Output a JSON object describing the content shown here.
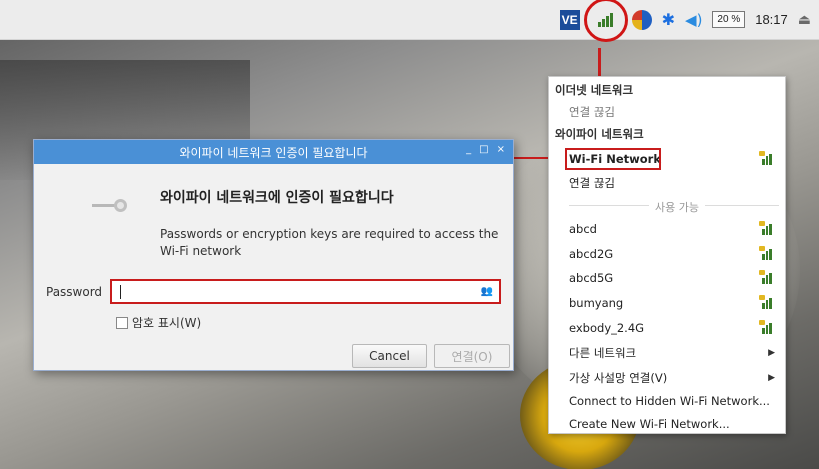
{
  "taskbar": {
    "vnc_label": "VE",
    "cpu_usage": "20 %",
    "clock": "18:17",
    "icons": [
      "vnc-icon",
      "wifi-icon",
      "globe-icon",
      "bluetooth-icon",
      "volume-icon",
      "eject-icon"
    ]
  },
  "wifi_menu": {
    "ethernet_header": "이더넷 네트워크",
    "ethernet_status": "연결 끊김",
    "wifi_header": "와이파이 네트워크",
    "selected_network": "Wi-Fi Network",
    "disconnect": "연결 끊김",
    "available_label": "사용 가능",
    "networks": [
      {
        "name": "abcd"
      },
      {
        "name": "abcd2G"
      },
      {
        "name": "abcd5G"
      },
      {
        "name": "bumyang"
      },
      {
        "name": "exbody_2.4G"
      }
    ],
    "other_networks": "다른 네트워크",
    "vpn": "가상 사설망 연결(V)",
    "connect_hidden": "Connect to Hidden Wi-Fi Network...",
    "create_new": "Create New Wi-Fi Network..."
  },
  "dialog": {
    "title": "와이파이 네트워크 인증이 필요합니다",
    "heading": "와이파이 네트워크에 인증이 필요합니다",
    "description": "Passwords or encryption keys are required to access the Wi-Fi network",
    "password_label": "Password",
    "password_value": "",
    "show_password": "암호 표시(W)",
    "cancel": "Cancel",
    "connect": "연결(O)",
    "window_controls": [
      "_",
      "□",
      "×"
    ]
  },
  "colors": {
    "accent": "#4a90d6",
    "highlight": "#c81c1c",
    "signal": "#3a7d2a"
  }
}
